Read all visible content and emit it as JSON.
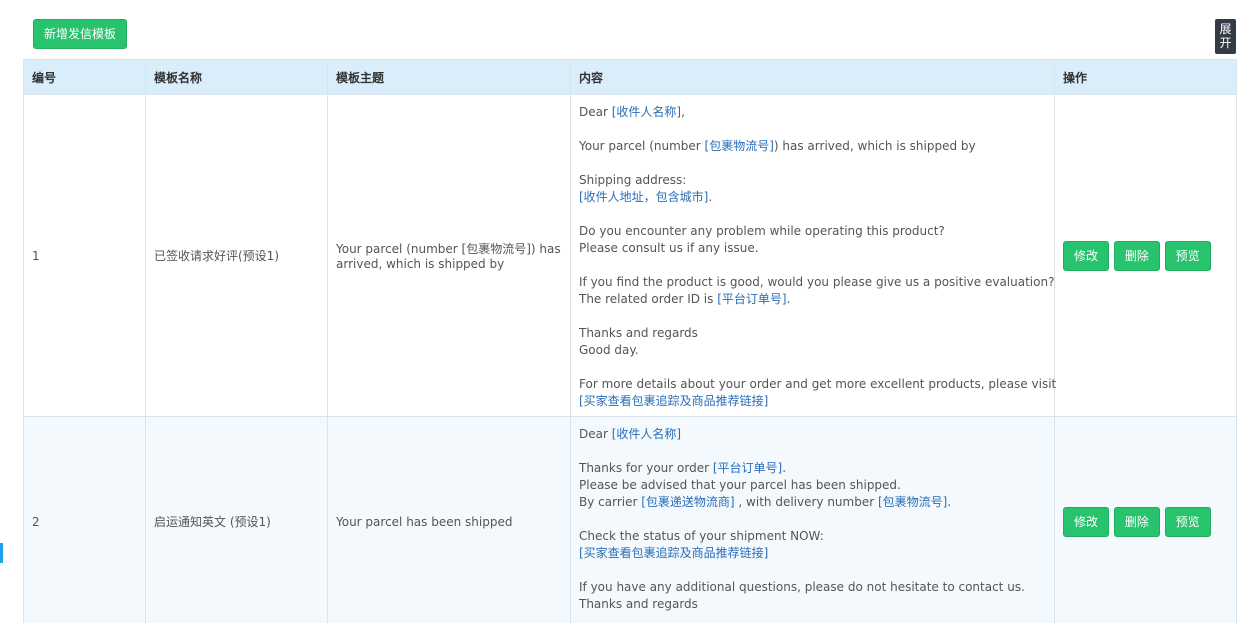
{
  "toolbar": {
    "add_label": "新增发信模板",
    "expand_label": [
      "展",
      "开"
    ]
  },
  "table": {
    "headers": [
      "编号",
      "模板名称",
      "模板主题",
      "内容",
      "操作"
    ],
    "rows": [
      {
        "id": "1",
        "name": "已签收请求好评(预设1)",
        "subject": "Your parcel (number [包裹物流号]) has arrived, which is shipped by",
        "content": [
          [
            {
              "t": "Dear "
            },
            {
              "t": "[收件人名称]",
              "h": true
            },
            {
              "t": ","
            }
          ],
          [],
          [
            {
              "t": "Your parcel (number "
            },
            {
              "t": "[包裹物流号]",
              "h": true
            },
            {
              "t": ") has arrived, which is shipped by"
            }
          ],
          [],
          [
            {
              "t": "Shipping address:"
            }
          ],
          [
            {
              "t": "[收件人地址，包含城市]",
              "h": true
            },
            {
              "t": "."
            }
          ],
          [],
          [
            {
              "t": "Do you encounter any problem while operating this product?"
            }
          ],
          [
            {
              "t": "Please consult us if any issue."
            }
          ],
          [],
          [
            {
              "t": "If you find the product is good, would you please give us a positive evaluation?"
            }
          ],
          [
            {
              "t": "The related order ID is "
            },
            {
              "t": "[平台订单号]",
              "h": true
            },
            {
              "t": "."
            }
          ],
          [],
          [
            {
              "t": "Thanks and regards"
            }
          ],
          [
            {
              "t": "Good day."
            }
          ],
          [],
          [
            {
              "t": "For more details about your order and get more excellent products, please visit"
            }
          ],
          [
            {
              "t": "[买家查看包裹追踪及商品推荐链接]",
              "h": true
            }
          ]
        ],
        "actions": [
          "修改",
          "删除",
          "预览"
        ]
      },
      {
        "id": "2",
        "name": "启运通知英文 (预设1)",
        "subject": "Your parcel has been shipped",
        "content": [
          [
            {
              "t": "Dear "
            },
            {
              "t": "[收件人名称]",
              "h": true
            }
          ],
          [],
          [
            {
              "t": "Thanks for your order "
            },
            {
              "t": "[平台订单号]",
              "h": true
            },
            {
              "t": "."
            }
          ],
          [
            {
              "t": "Please be advised that your parcel has been shipped."
            }
          ],
          [
            {
              "t": "By carrier "
            },
            {
              "t": "[包裹递送物流商]",
              "h": true
            },
            {
              "t": " , with delivery number "
            },
            {
              "t": "[包裹物流号]",
              "h": true
            },
            {
              "t": "."
            }
          ],
          [],
          [
            {
              "t": "Check the status of your shipment NOW:"
            }
          ],
          [
            {
              "t": "[买家查看包裹追踪及商品推荐链接]",
              "h": true
            }
          ],
          [],
          [
            {
              "t": "If you have any additional questions, please do not hesitate to contact us."
            }
          ],
          [
            {
              "t": "Thanks and regards"
            }
          ]
        ],
        "actions": [
          "修改",
          "删除",
          "预览"
        ]
      }
    ]
  },
  "colors": {
    "accent_green": "#27c36d",
    "header_bg": "#d9eefa",
    "highlight_text": "#2a6db7"
  }
}
